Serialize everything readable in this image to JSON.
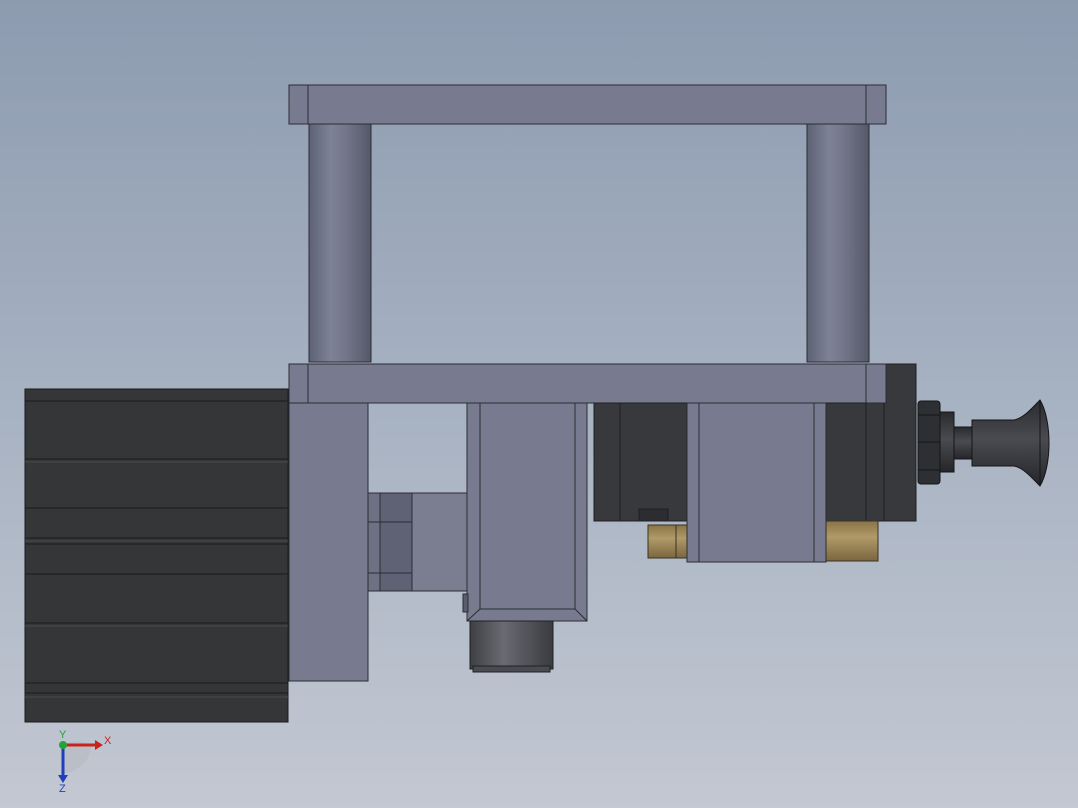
{
  "colors": {
    "steel": "#787c8e",
    "steel_dark": "#60647a",
    "steel_edge": "#2a2c33",
    "motor_black": "#353638",
    "brass": "#a0895a",
    "axis_x": "#c8241f",
    "axis_y": "#22a23a",
    "axis_z": "#1f3fc0"
  },
  "triad": {
    "x_label": "X",
    "y_label": "Y",
    "z_label": "Z"
  }
}
